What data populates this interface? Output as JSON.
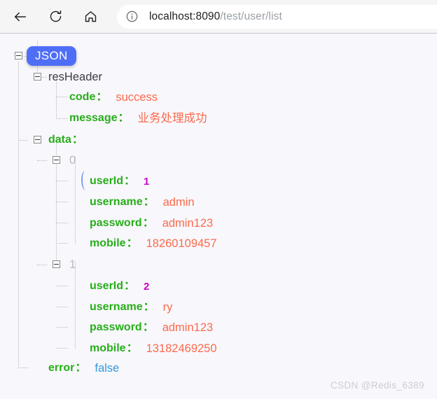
{
  "browser": {
    "back_label": "Back",
    "reload_label": "Reload",
    "home_label": "Home",
    "site_info_label": "View site information",
    "url_host": "localhost:8090",
    "url_path": "/test/user/list",
    "url_full": "localhost:8090/test/user/list"
  },
  "tree": {
    "root_badge": "JSON",
    "nodes": {
      "resHeader": "resHeader",
      "code_key": "code",
      "code_value": "success",
      "message_key": "message",
      "message_value": "业务处理成功",
      "data_key": "data",
      "index_0": "0",
      "index_1": "1",
      "item0_userId_key": "userId",
      "item0_userId_value": "1",
      "item0_username_key": "username",
      "item0_username_value": "admin",
      "item0_password_key": "password",
      "item0_password_value": "admin123",
      "item0_mobile_key": "mobile",
      "item0_mobile_value": "18260109457",
      "item1_userId_key": "userId",
      "item1_userId_value": "2",
      "item1_username_key": "username",
      "item1_username_value": "ry",
      "item1_password_key": "password",
      "item1_password_value": "admin123",
      "item1_mobile_key": "mobile",
      "item1_mobile_value": "13182469250",
      "error_key": "error",
      "error_value": "false"
    },
    "colon": "：",
    "expander_symbol": "−"
  },
  "watermark": "CSDN @Redis_6389",
  "colors": {
    "badge": "#4f6ef7",
    "key": "#27ae19",
    "string_value": "#fc6a4b",
    "number_value": "#cc00cc",
    "bool_value": "#3399dd",
    "index": "#b8b8c2",
    "page_background": "#f8f7fc",
    "toolbar_background": "#f5f5f5"
  }
}
